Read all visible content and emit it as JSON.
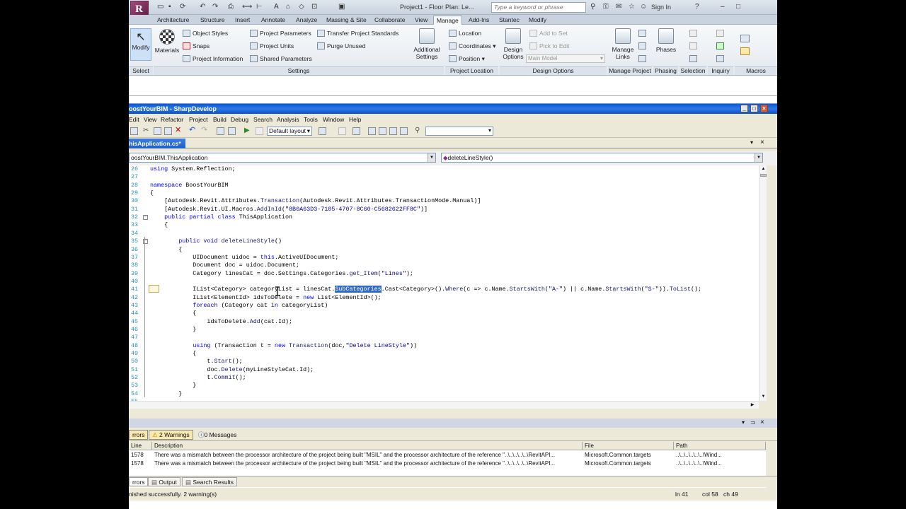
{
  "revit": {
    "title": "Project1 - Floor Plan: Le...",
    "search_placeholder": "Type a keyword or phrase",
    "sign_in": "Sign In",
    "tabs": [
      "Architecture",
      "Structure",
      "Insert",
      "Annotate",
      "Analyze",
      "Massing & Site",
      "Collaborate",
      "View",
      "Manage",
      "Add-Ins",
      "Stantec",
      "Modify"
    ],
    "active_tab": "Manage",
    "select": {
      "modify": "Modify",
      "group": "Select"
    },
    "settings": {
      "materials": "Materials",
      "object_styles": "Object Styles",
      "snaps": "Snaps",
      "project_information": "Project Information",
      "project_parameters": "Project Parameters",
      "project_units": "Project Units",
      "shared_parameters": "Shared Parameters",
      "transfer_project_standards": "Transfer Project Standards",
      "purge_unused": "Purge Unused",
      "additional_settings_1": "Additional",
      "additional_settings_2": "Settings",
      "group": "Settings"
    },
    "location": {
      "location": "Location",
      "coordinates": "Coordinates",
      "position": "Position",
      "group": "Project Location"
    },
    "design_options": {
      "btn_1": "Design",
      "btn_2": "Options",
      "add_to_set": "Add to Set",
      "pick_to_edit": "Pick to Edit",
      "main_model": "Main Model",
      "group": "Design Options"
    },
    "manage_project": {
      "manage_links_1": "Manage",
      "manage_links_2": "Links",
      "group": "Manage Project"
    },
    "phasing": {
      "phases": "Phases",
      "group": "Phasing"
    },
    "groups_right": [
      "Selection",
      "Inquiry",
      "Macros"
    ]
  },
  "sharpdevelop": {
    "title": "oostYourBIM - SharpDevelop",
    "menu": [
      "Edit",
      "View",
      "Refactor",
      "Project",
      "Build",
      "Debug",
      "Search",
      "Analysis",
      "Tools",
      "Window",
      "Help"
    ],
    "layout": "Default layout",
    "doc_tab": "hisApplication.cs*",
    "class_combo": "oostYourBIM.ThisApplication",
    "member_combo": "deleteLineStyle()",
    "code_lines": [
      {
        "n": "26",
        "t": "using System.Reflection;"
      },
      {
        "n": "27",
        "t": ""
      },
      {
        "n": "28",
        "t": "namespace BoostYourBIM"
      },
      {
        "n": "29",
        "t": "{"
      },
      {
        "n": "30",
        "t": "    [Autodesk.Revit.Attributes.Transaction(Autodesk.Revit.Attributes.TransactionMode.Manual)]"
      },
      {
        "n": "31",
        "t": "    [Autodesk.Revit.UI.Macros.AddInId(\"8B0A63D3-7105-4707-8C60-C5682622FF8C\")]"
      },
      {
        "n": "32",
        "t": "    public partial class ThisApplication"
      },
      {
        "n": "33",
        "t": "    {"
      },
      {
        "n": "34",
        "t": ""
      },
      {
        "n": "35",
        "t": "        public void deleteLineStyle()"
      },
      {
        "n": "36",
        "t": "        {"
      },
      {
        "n": "37",
        "t": "            UIDocument uidoc = this.ActiveUIDocument;"
      },
      {
        "n": "38",
        "t": "            Document doc = uidoc.Document;"
      },
      {
        "n": "39",
        "t": "            Category linesCat = doc.Settings.Categories.get_Item(\"Lines\");"
      },
      {
        "n": "40",
        "t": ""
      },
      {
        "n": "41",
        "t": "            IList<Category> categoryList = linesCat.SubCategories.Cast<Category>().Where(c => c.Name.StartsWith(\"A-\") || c.Name.StartsWith(\"S-\")).ToList();"
      },
      {
        "n": "42",
        "t": "            IList<ElementId> idsToDelete = new List<ElementId>();"
      },
      {
        "n": "43",
        "t": "            foreach (Category cat in categoryList)"
      },
      {
        "n": "44",
        "t": "            {"
      },
      {
        "n": "45",
        "t": "                idsToDelete.Add(cat.Id);"
      },
      {
        "n": "46",
        "t": "            }"
      },
      {
        "n": "47",
        "t": ""
      },
      {
        "n": "48",
        "t": "            using (Transaction t = new Transaction(doc,\"Delete LineStyle\"))"
      },
      {
        "n": "49",
        "t": "            {"
      },
      {
        "n": "50",
        "t": "                t.Start();"
      },
      {
        "n": "51",
        "t": "                doc.Delete(myLineStyleCat.Id);"
      },
      {
        "n": "52",
        "t": "                t.Commit();"
      },
      {
        "n": "53",
        "t": "            }"
      },
      {
        "n": "54",
        "t": "        }"
      },
      {
        "n": "55",
        "t": ""
      }
    ],
    "errors": {
      "errors_btn": "rrors",
      "warnings_btn": "2 Warnings",
      "messages_btn": "0 Messages",
      "columns": [
        "Line",
        "Description",
        "File",
        "Path"
      ],
      "rows": [
        {
          "line": "1578",
          "desc": "There was a mismatch between the processor architecture of the project being built \"MSIL\" and the processor architecture of the reference \"..\\..\\..\\..\\..\\RevitAPI...",
          "file": "Microsoft.Common.targets",
          "path": "..\\..\\..\\..\\..\\..\\Wind..."
        },
        {
          "line": "1578",
          "desc": "There was a mismatch between the processor architecture of the project being built \"MSIL\" and the processor architecture of the reference \"..\\..\\..\\..\\..\\RevitAPI...",
          "file": "Microsoft.Common.targets",
          "path": "..\\..\\..\\..\\..\\..\\Wind..."
        }
      ]
    },
    "pad_tabs": [
      "rrors",
      "Output",
      "Search Results"
    ],
    "status": {
      "message": "nished successfully. 2 warning(s)",
      "line": "ln 41",
      "col": "col 58",
      "ch": "ch 49"
    }
  },
  "colors": {
    "keyword": "#0000ff",
    "linenumber": "#2b91af",
    "selection": "#316ac5",
    "titlebar": "#0a5ad6"
  }
}
